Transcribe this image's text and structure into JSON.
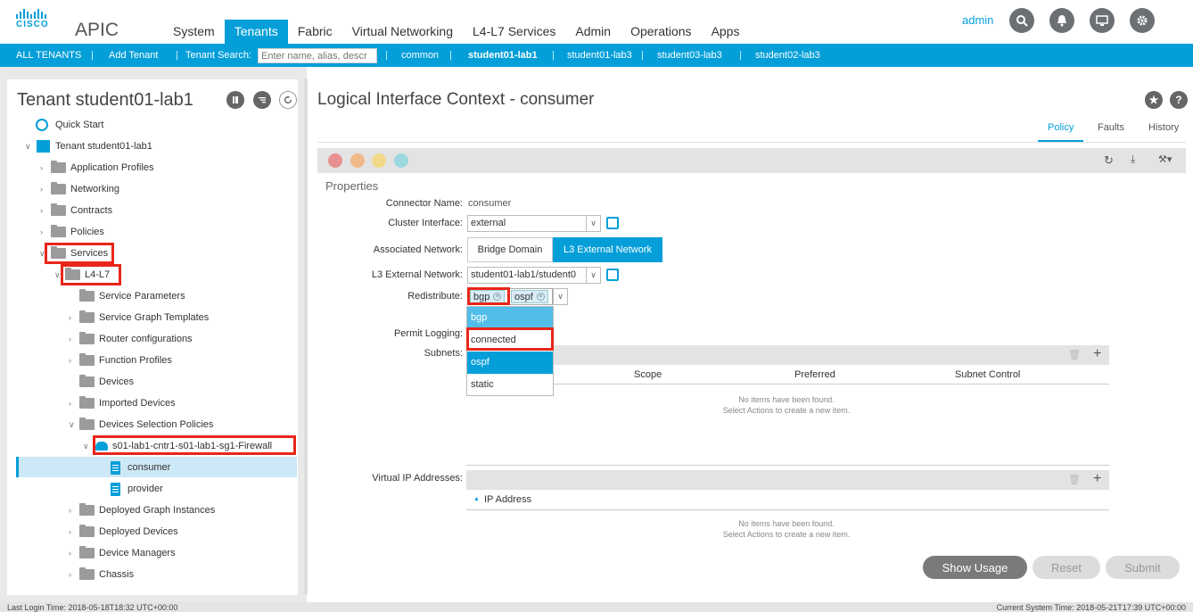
{
  "header": {
    "logo_text": "CISCO",
    "app_name": "APIC",
    "nav": [
      "System",
      "Tenants",
      "Fabric",
      "Virtual Networking",
      "L4-L7 Services",
      "Admin",
      "Operations",
      "Apps"
    ],
    "active_nav": "Tenants",
    "user": "admin",
    "icons": [
      "search-icon",
      "bell-icon",
      "screen-icon",
      "gear-icon"
    ],
    "accent_color": "#049fd9"
  },
  "subnav": {
    "all_tenants": "ALL TENANTS",
    "add_tenant": "Add Tenant",
    "tenant_search_label": "Tenant Search:",
    "tenant_search_placeholder": "Enter name, alias, descr",
    "tenants": [
      "common",
      "student01-lab1",
      "student01-lab3",
      "student03-lab3",
      "student02-lab3"
    ],
    "active_tenant": "student01-lab1"
  },
  "left": {
    "title": "Tenant student01-lab1",
    "tree": [
      "Quick Start",
      "Tenant student01-lab1",
      "Application Profiles",
      "Networking",
      "Contracts",
      "Policies",
      "Services",
      "L4-L7",
      "Service Parameters",
      "Service Graph Templates",
      "Router configurations",
      "Function Profiles",
      "Devices",
      "Imported Devices",
      "Devices Selection Policies",
      "s01-lab1-cntr1-s01-lab1-sg1-Firewall",
      "consumer",
      "provider",
      "Deployed Graph Instances",
      "Deployed Devices",
      "Device Managers",
      "Chassis"
    ],
    "selected": "consumer"
  },
  "right": {
    "title": "Logical Interface Context - consumer",
    "tabs": [
      "Policy",
      "Faults",
      "History"
    ],
    "active_tab": "Policy",
    "section": "Properties",
    "connector_name_label": "Connector Name:",
    "connector_name": "consumer",
    "cluster_interface_label": "Cluster Interface:",
    "cluster_interface": "external",
    "associated_network_label": "Associated Network:",
    "associated_network_options": [
      "Bridge Domain",
      "L3 External Network"
    ],
    "associated_network_selected": "L3 External Network",
    "l3_external_network_label": "L3 External Network:",
    "l3_external_network": "student01-lab1/student0",
    "redistribute_label": "Redistribute:",
    "redistribute_tags": [
      "bgp",
      "ospf"
    ],
    "redistribute_options": [
      "bgp",
      "connected",
      "ospf",
      "static"
    ],
    "permit_logging_label": "Permit Logging:",
    "subnets_label": "Subnets:",
    "subnet_columns": [
      "Scope",
      "Preferred",
      "Subnet Control"
    ],
    "empty_line1": "No items have been found.",
    "empty_line2": "Select Actions to create a new item.",
    "vip_label": "Virtual IP Addresses:",
    "vip_column": "IP Address",
    "buttons": [
      "Show Usage",
      "Reset",
      "Submit"
    ]
  },
  "footer": {
    "last_login": "Last Login Time: 2018-05-18T18:32 UTC+00:00",
    "current_time": "Current System Time: 2018-05-21T17:39 UTC+00:00"
  }
}
